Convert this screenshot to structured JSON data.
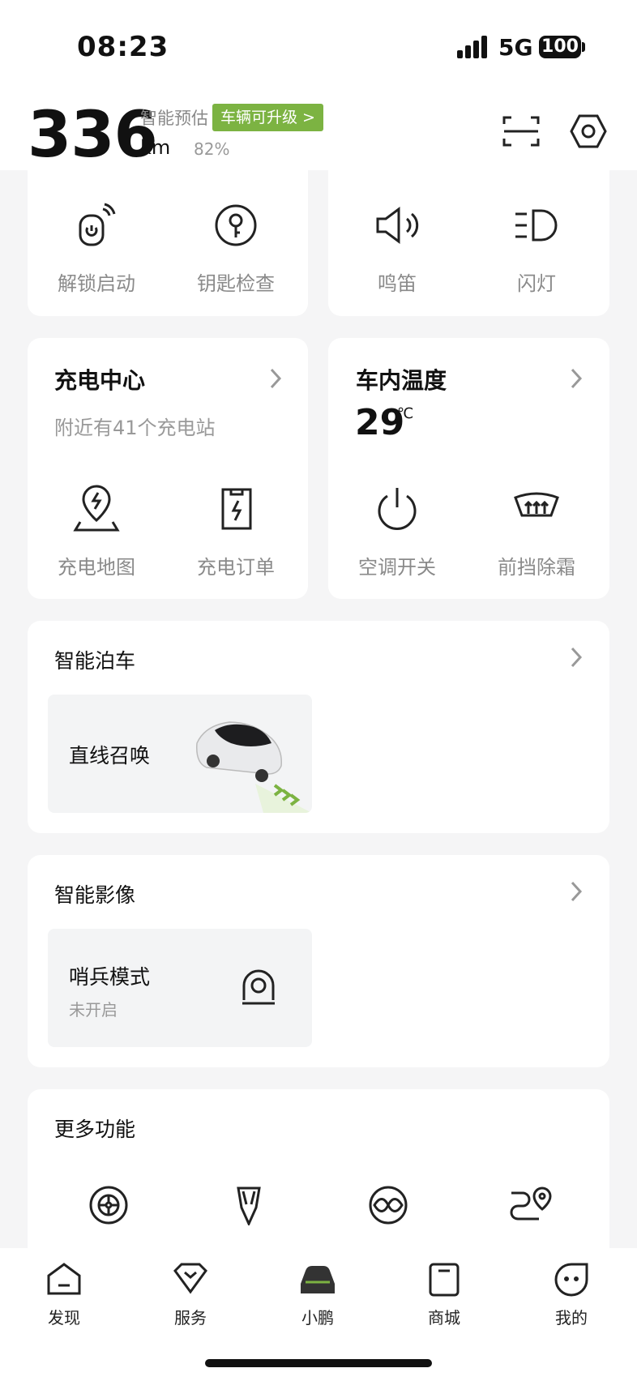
{
  "status": {
    "time": "08:23",
    "network": "5G",
    "battery": "100"
  },
  "header": {
    "range_value": "336",
    "range_unit": "km",
    "estimate_label": "智能预估",
    "upgrade_badge": "车辆可升级 >",
    "battery_percent": "82%"
  },
  "quick_controls": {
    "left": [
      {
        "label": "解锁启动",
        "icon": "unlock-start-icon"
      },
      {
        "label": "钥匙检查",
        "icon": "key-icon"
      }
    ],
    "right": [
      {
        "label": "鸣笛",
        "icon": "horn-icon"
      },
      {
        "label": "闪灯",
        "icon": "headlight-icon"
      }
    ]
  },
  "charging": {
    "title": "充电中心",
    "subtitle": "附近有41个充电站",
    "actions": [
      {
        "label": "充电地图",
        "icon": "charging-map-icon"
      },
      {
        "label": "充电订单",
        "icon": "charging-order-icon"
      }
    ]
  },
  "climate": {
    "title": "车内温度",
    "temperature": "29",
    "unit": "℃",
    "actions": [
      {
        "label": "空调开关",
        "icon": "power-icon"
      },
      {
        "label": "前挡除霜",
        "icon": "defrost-icon"
      }
    ]
  },
  "parking": {
    "title": "智能泊车",
    "tile_label": "直线召唤"
  },
  "imaging": {
    "title": "智能影像",
    "tile_label": "哨兵模式",
    "tile_status": "未开启"
  },
  "more": {
    "title": "更多功能",
    "icons": [
      "tire-icon",
      "seat-icon",
      "infinity-icon",
      "route-icon"
    ]
  },
  "tabs": [
    {
      "label": "发现",
      "icon": "discover-tab-icon"
    },
    {
      "label": "服务",
      "icon": "service-tab-icon"
    },
    {
      "label": "小鹏",
      "icon": "car-tab-icon"
    },
    {
      "label": "商城",
      "icon": "store-tab-icon"
    },
    {
      "label": "我的",
      "icon": "profile-tab-icon"
    }
  ],
  "colors": {
    "accent_green": "#7cb342",
    "background": "#f5f5f6"
  }
}
